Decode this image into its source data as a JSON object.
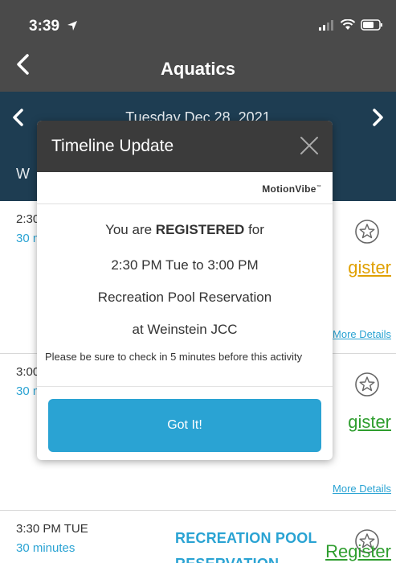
{
  "status_bar": {
    "time": "3:39"
  },
  "nav": {
    "title": "Aquatics"
  },
  "date_bar": {
    "date": "Tuesday Dec 28, 2021",
    "filter_label": "W"
  },
  "list": [
    {
      "time": "2:30",
      "duration": "30 m",
      "register_label": "gister",
      "more_details": "More Details"
    },
    {
      "time": "3:00",
      "duration": "30 m",
      "register_label": "gister",
      "more_details": "More Details"
    },
    {
      "time": "3:30 PM TUE",
      "duration": "30 minutes",
      "activity_line1": "RECREATION POOL",
      "activity_line2": "RESERVATION",
      "register_label": "Register"
    }
  ],
  "modal": {
    "title": "Timeline Update",
    "brand": "MotionVibe",
    "line1_prefix": "You are",
    "line1_strong": "REGISTERED",
    "line1_suffix": "for",
    "line2": "2:30 PM Tue to 3:00 PM",
    "line3": "Recreation Pool Reservation",
    "line4": "at Weinstein JCC",
    "note": "Please be sure to check in 5 minutes before this activity",
    "button_label": "Got It!"
  },
  "colors": {
    "header_bg": "#4a4a4a",
    "datebar_bg": "#1e3d52",
    "accent_blue": "#2aa3d3",
    "register_yellow": "#e0a000",
    "register_green": "#2f9e2f"
  }
}
